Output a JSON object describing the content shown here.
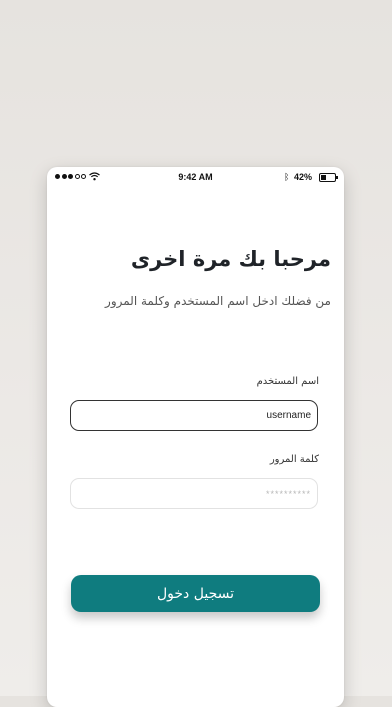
{
  "status_bar": {
    "time": "9:42 AM",
    "battery": "42%",
    "signal_strength": 3,
    "icons": [
      "signal-icon",
      "wifi-icon",
      "bluetooth-icon",
      "battery-icon"
    ]
  },
  "login": {
    "title": "مرحبا بك مرة اخرى",
    "subtitle": "من فضلك ادخل اسم المستخدم وكلمة المرور",
    "username_label": "اسم المستخدم",
    "username_value": "username",
    "password_label": "كلمة المرور",
    "password_placeholder": "**********",
    "submit_label": "تسجيل دخول"
  },
  "colors": {
    "accent": "#0f7c7f",
    "background": "#e9e7e4"
  }
}
